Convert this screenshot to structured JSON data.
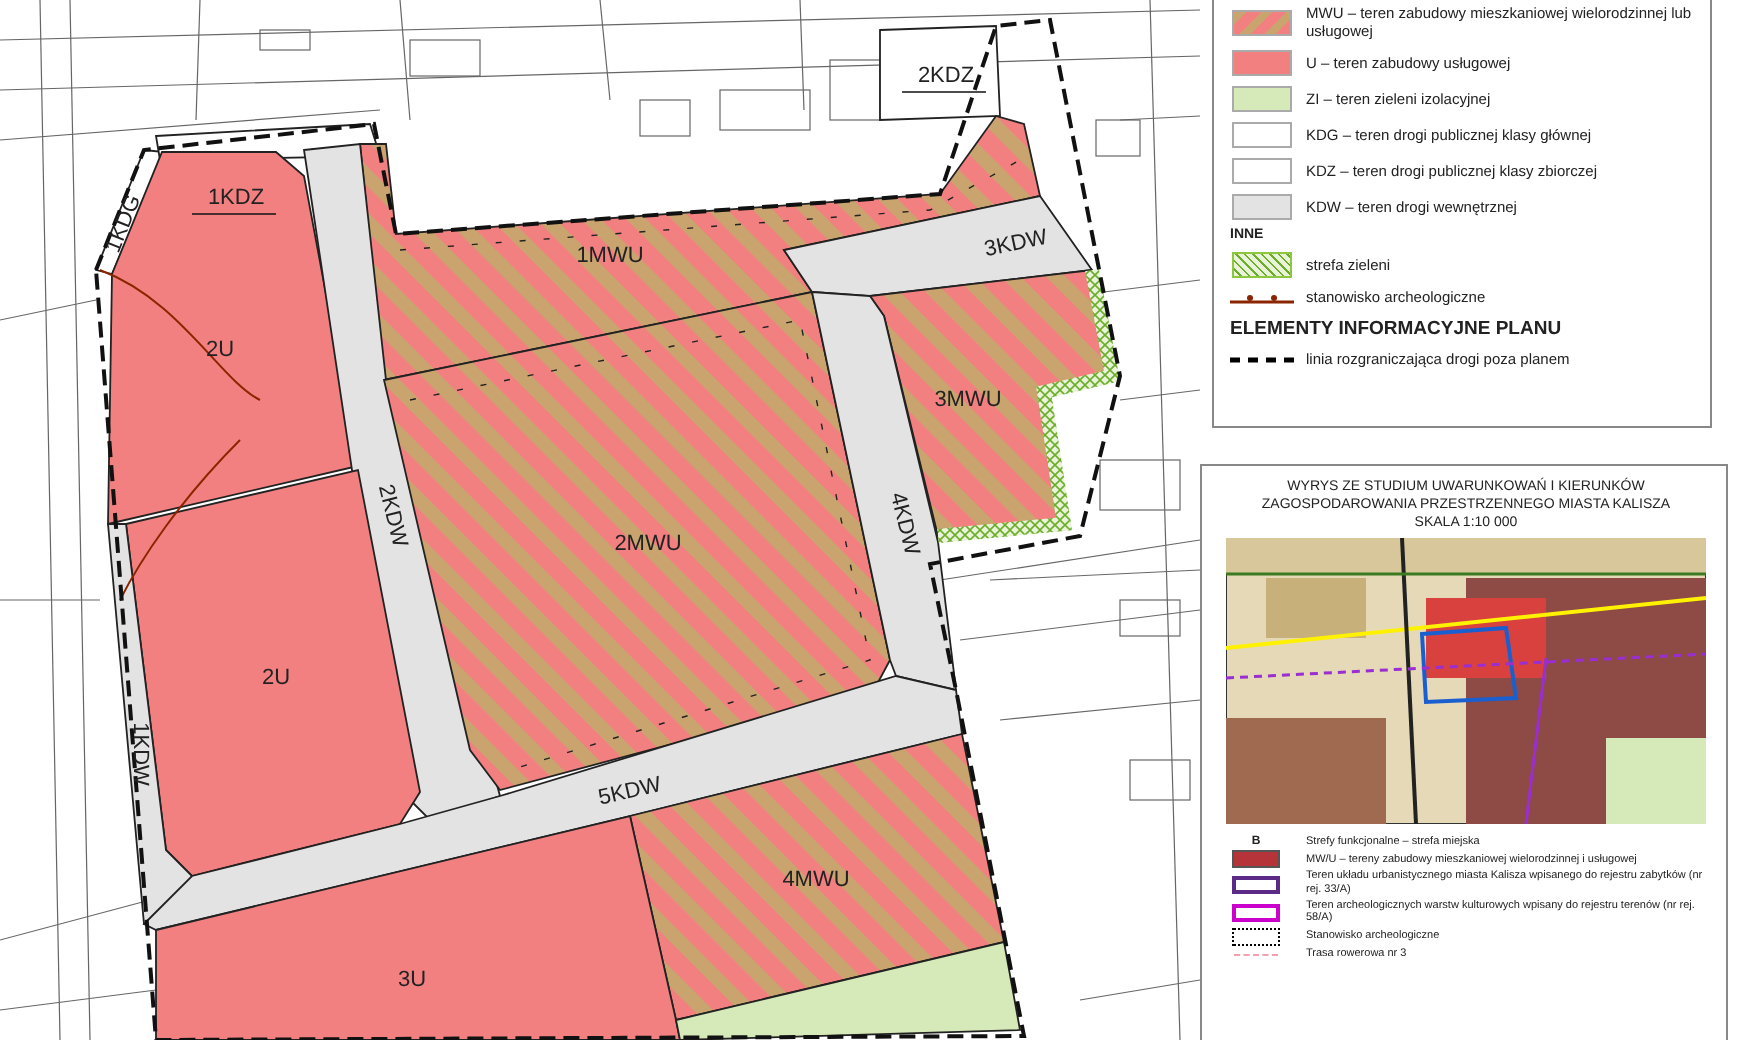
{
  "plan_map": {
    "areas": [
      {
        "label": "2KDZ",
        "kind": "kdz"
      },
      {
        "label": "1KDG",
        "kind": "kdg"
      },
      {
        "label": "1KDZ",
        "kind": "kdz"
      },
      {
        "label": "1MWU",
        "kind": "mwu"
      },
      {
        "label": "3KDW",
        "kind": "kdw"
      },
      {
        "label": "2U",
        "kind": "u"
      },
      {
        "label": "3MWU",
        "kind": "mwu"
      },
      {
        "label": "2KDW",
        "kind": "kdw"
      },
      {
        "label": "2MWU",
        "kind": "mwu"
      },
      {
        "label": "4KDW",
        "kind": "kdw"
      },
      {
        "label": "2U",
        "kind": "u"
      },
      {
        "label": "1KDW",
        "kind": "kdw"
      },
      {
        "label": "5KDW",
        "kind": "kdw"
      },
      {
        "label": "4MWU",
        "kind": "mwu"
      },
      {
        "label": "3U",
        "kind": "u"
      },
      {
        "kind": "zi"
      }
    ]
  },
  "legend": {
    "groups": [
      {
        "items": [
          {
            "kind": "stripes",
            "color": "#f28080",
            "label": "MWU – teren zabudowy mieszkaniowej wielorodzinnej lub usługowej"
          },
          {
            "kind": "fill",
            "color": "#f28080",
            "label": "U – teren zabudowy usługowej"
          },
          {
            "kind": "fill",
            "color": "#d6e9b8",
            "label": "ZI – teren zieleni izolacyjnej"
          },
          {
            "kind": "fill",
            "color": "#ffffff",
            "label": "KDG – teren drogi publicznej klasy głównej"
          },
          {
            "kind": "fill",
            "color": "#ffffff",
            "label": "KDZ – teren drogi publicznej klasy zbiorczej"
          },
          {
            "kind": "fill",
            "color": "#e3e3e3",
            "label": "KDW – teren drogi wewnętrznej"
          }
        ]
      },
      {
        "heading": "INNE",
        "kind": "minor",
        "items": [
          {
            "kind": "crosshatch",
            "color": "#8dc63f",
            "label": "strefa zieleni"
          },
          {
            "kind": "archaeo-line",
            "color": "#8b2500",
            "label": "stanowisko archeologiczne"
          }
        ]
      },
      {
        "heading": "ELEMENTY INFORMACYJNE PLANU",
        "kind": "major",
        "items": [
          {
            "kind": "dashed-line",
            "color": "#000000",
            "label": "linia rozgraniczająca drogi poza planem"
          }
        ]
      }
    ]
  },
  "study_extract": {
    "title": "WYRYS ZE STUDIUM UWARUNKOWAŃ I KIERUNKÓW ZAGOSPODAROWANIA PRZESTRZENNEGO MIASTA KALISZA",
    "scale": "SKALA 1:10 000",
    "legend": [
      {
        "kind": "letter",
        "symbol": "B",
        "label": "Strefy funkcjonalne – strefa miejska"
      },
      {
        "kind": "hatched-fill",
        "color": "#b5343a",
        "label": "MW/U – tereny zabudowy mieszkaniowej wielorodzinnej i usługowej"
      },
      {
        "kind": "frame",
        "color": "#5b2a86",
        "label": "Teren układu urbanistycznego miasta Kalisza wpisanego do rejestru zabytków (nr rej. 33/A)"
      },
      {
        "kind": "frame",
        "color": "#cc00cc",
        "label": "Teren archeologicznych warstw kulturowych wpisany do rejestru terenów (nr rej. 58/A)"
      },
      {
        "kind": "dotted-frame",
        "color": "#000000",
        "label": "Stanowisko archeologiczne"
      },
      {
        "kind": "dashed-line",
        "color": "#f4a0b0",
        "label": "Trasa rowerowa nr 3"
      }
    ]
  }
}
